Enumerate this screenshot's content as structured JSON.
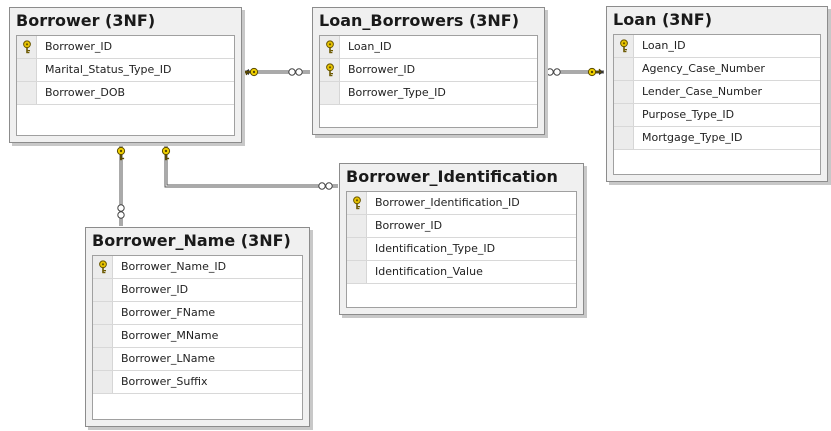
{
  "tables": [
    {
      "title": "Borrower (3NF)",
      "columns": [
        {
          "name": "Borrower_ID",
          "pk": true
        },
        {
          "name": "Marital_Status_Type_ID",
          "pk": false
        },
        {
          "name": "Borrower_DOB",
          "pk": false
        }
      ]
    },
    {
      "title": "Loan_Borrowers (3NF)",
      "columns": [
        {
          "name": "Loan_ID",
          "pk": true
        },
        {
          "name": "Borrower_ID",
          "pk": true
        },
        {
          "name": "Borrower_Type_ID",
          "pk": false
        }
      ]
    },
    {
      "title": "Loan (3NF)",
      "columns": [
        {
          "name": "Loan_ID",
          "pk": true
        },
        {
          "name": "Agency_Case_Number",
          "pk": false
        },
        {
          "name": "Lender_Case_Number",
          "pk": false
        },
        {
          "name": "Purpose_Type_ID",
          "pk": false
        },
        {
          "name": "Mortgage_Type_ID",
          "pk": false
        }
      ]
    },
    {
      "title": "Borrower_Identification",
      "columns": [
        {
          "name": "Borrower_Identification_ID",
          "pk": true
        },
        {
          "name": "Borrower_ID",
          "pk": false
        },
        {
          "name": "Identification_Type_ID",
          "pk": false
        },
        {
          "name": "Identification_Value",
          "pk": false
        }
      ]
    },
    {
      "title": "Borrower_Name (3NF)",
      "columns": [
        {
          "name": "Borrower_Name_ID",
          "pk": true
        },
        {
          "name": "Borrower_ID",
          "pk": false
        },
        {
          "name": "Borrower_FName",
          "pk": false
        },
        {
          "name": "Borrower_MName",
          "pk": false
        },
        {
          "name": "Borrower_LName",
          "pk": false
        },
        {
          "name": "Borrower_Suffix",
          "pk": false
        }
      ]
    }
  ],
  "relationships": [
    {
      "from": "Borrower (3NF)",
      "to": "Loan_Borrowers (3NF)",
      "one_end": "Borrower (3NF)",
      "many_end": "Loan_Borrowers (3NF)"
    },
    {
      "from": "Loan (3NF)",
      "to": "Loan_Borrowers (3NF)",
      "one_end": "Loan (3NF)",
      "many_end": "Loan_Borrowers (3NF)"
    },
    {
      "from": "Borrower (3NF)",
      "to": "Borrower_Name (3NF)",
      "one_end": "Borrower (3NF)",
      "many_end": "Borrower_Name (3NF)"
    },
    {
      "from": "Borrower (3NF)",
      "to": "Borrower_Identification",
      "one_end": "Borrower (3NF)",
      "many_end": "Borrower_Identification"
    }
  ],
  "colors": {
    "key_icon": "#e8c400",
    "link_line": "#707070"
  }
}
